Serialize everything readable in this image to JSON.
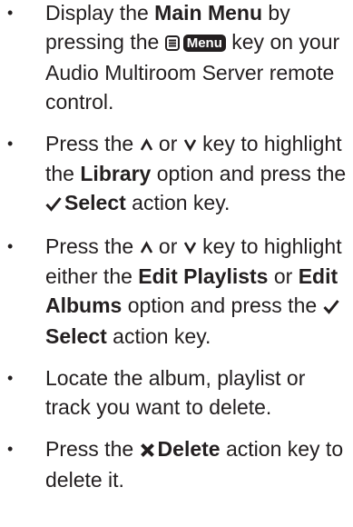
{
  "steps": [
    {
      "bullet": "•",
      "s1_a": "Display the ",
      "s1_b": "Main Menu",
      "s1_c": " by pressing the ",
      "menu_key": "Menu",
      "s1_d": " key on your Audio Multiroom Server remote control."
    },
    {
      "bullet": "•",
      "s2_a": "Press the ",
      "s2_b": " or ",
      "s2_c": " key to highlight the ",
      "s2_d": "Library",
      "s2_e": " option and press the ",
      "s2_f": "Select",
      "s2_g": " action key."
    },
    {
      "bullet": "•",
      "s3_a": "Press the ",
      "s3_b": " or ",
      "s3_c": " key to highlight either the ",
      "s3_d": "Edit Playlists",
      "s3_e": " or ",
      "s3_f": "Edit Albums",
      "s3_g": " option and press the ",
      "s3_h": "Select",
      "s3_i": " action key."
    },
    {
      "bullet": "•",
      "s4_a": "Locate the album, playlist or track you want to delete."
    },
    {
      "bullet": "•",
      "s5_a": "Press the ",
      "s5_b": "Delete",
      "s5_c": " action key to delete it."
    }
  ],
  "icons": {
    "menu": "menu-list-icon",
    "up": "caret-up-icon",
    "down": "caret-down-icon",
    "select": "checkmark-icon",
    "delete": "cross-icon"
  },
  "colors": {
    "text": "#231f20",
    "key_bg": "#231f20",
    "key_text": "#ffffff"
  }
}
